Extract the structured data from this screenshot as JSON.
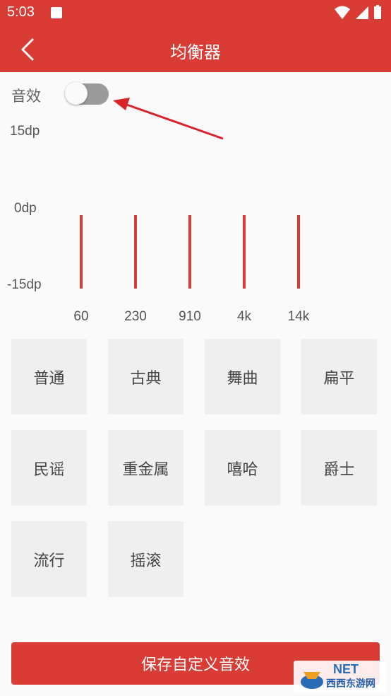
{
  "status_bar": {
    "time": "5:03"
  },
  "app_bar": {
    "title": "均衡器"
  },
  "effect": {
    "label": "音效",
    "enabled": false
  },
  "equalizer": {
    "db_labels": {
      "max": "15dp",
      "mid": "0dp",
      "min": "-15dp"
    },
    "bands": [
      {
        "freq": "60"
      },
      {
        "freq": "230"
      },
      {
        "freq": "910"
      },
      {
        "freq": "4k"
      },
      {
        "freq": "14k"
      }
    ]
  },
  "presets": [
    "普通",
    "古典",
    "舞曲",
    "扁平",
    "民谣",
    "重金属",
    "嘻哈",
    "爵士",
    "流行",
    "摇滚"
  ],
  "save_button": {
    "label": "保存自定义音效"
  },
  "watermark": {
    "brand": "NET",
    "text": "西西东游网"
  },
  "colors": {
    "accent": "#d93b35",
    "toggle_off": "#9b9b9b",
    "preset_bg": "#efefef"
  }
}
